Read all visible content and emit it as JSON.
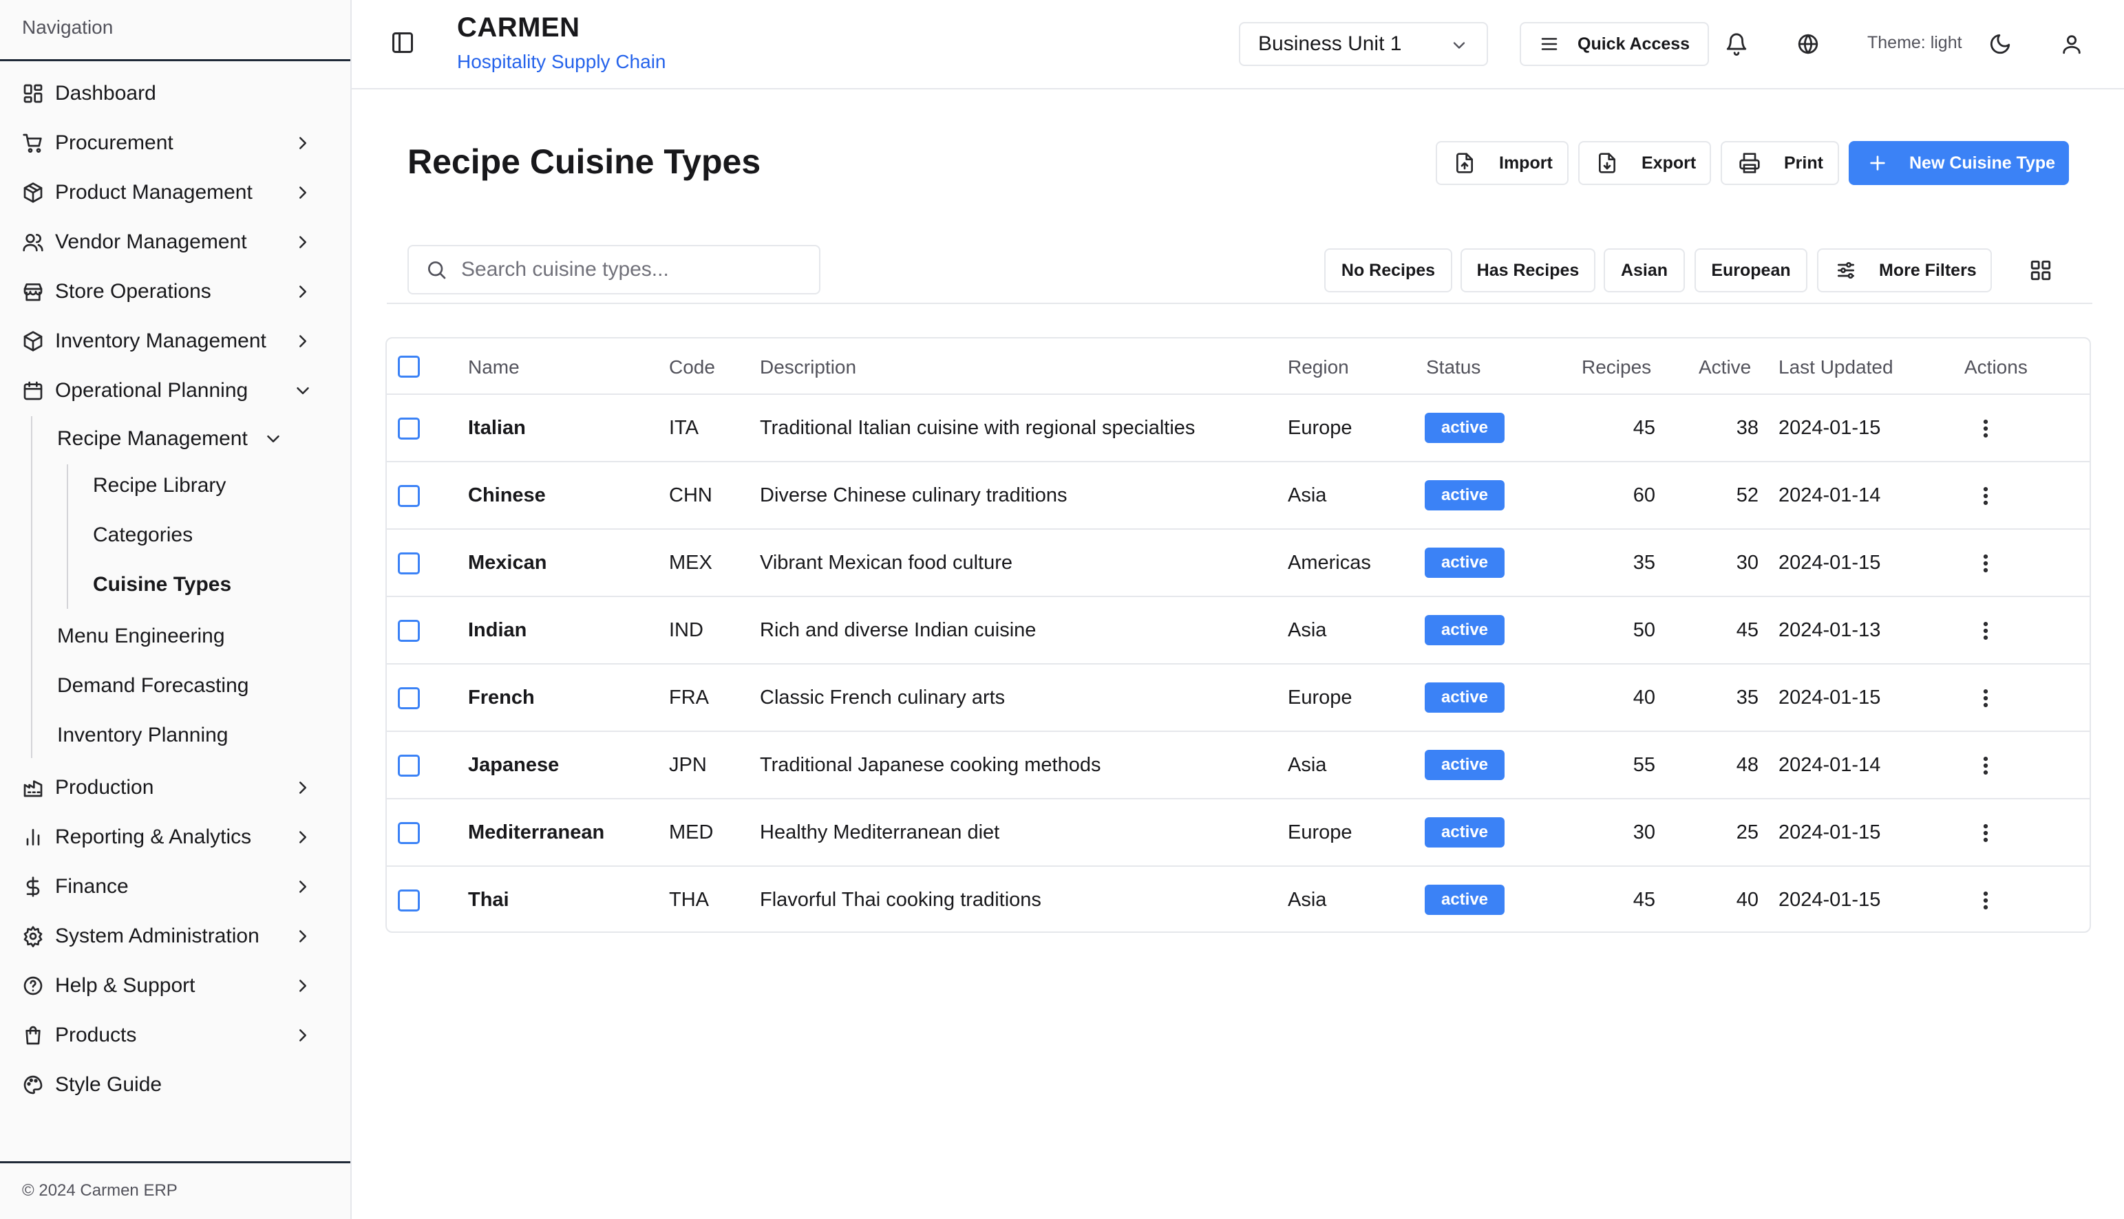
{
  "sidebar": {
    "header": "Navigation",
    "footer": "© 2024 Carmen ERP",
    "items": [
      {
        "label": "Dashboard",
        "icon": "dashboard-icon"
      },
      {
        "label": "Procurement",
        "icon": "cart-icon"
      },
      {
        "label": "Product Management",
        "icon": "package-icon"
      },
      {
        "label": "Vendor Management",
        "icon": "users-icon"
      },
      {
        "label": "Store Operations",
        "icon": "store-icon"
      },
      {
        "label": "Inventory Management",
        "icon": "package-icon"
      },
      {
        "label": "Operational Planning",
        "icon": "calendar-icon"
      },
      {
        "label": "Production",
        "icon": "factory-icon"
      },
      {
        "label": "Reporting & Analytics",
        "icon": "bar-chart-icon"
      },
      {
        "label": "Finance",
        "icon": "dollar-icon"
      },
      {
        "label": "System Administration",
        "icon": "gear-icon"
      },
      {
        "label": "Help & Support",
        "icon": "help-circle-icon"
      },
      {
        "label": "Products",
        "icon": "shopping-bag-icon"
      },
      {
        "label": "Style Guide",
        "icon": "palette-icon"
      }
    ],
    "operational_planning_children": [
      {
        "label": "Recipe Management"
      },
      {
        "label": "Menu Engineering"
      },
      {
        "label": "Demand Forecasting"
      },
      {
        "label": "Inventory Planning"
      }
    ],
    "recipe_management_children": [
      {
        "label": "Recipe Library"
      },
      {
        "label": "Categories"
      },
      {
        "label": "Cuisine Types"
      }
    ]
  },
  "header": {
    "brand": "CARMEN",
    "subtitle": "Hospitality Supply Chain",
    "business_unit": "Business Unit 1",
    "quick_access": "Quick Access",
    "theme_label": "Theme: light"
  },
  "page": {
    "title": "Recipe Cuisine Types",
    "actions": {
      "import": "Import",
      "export": "Export",
      "print": "Print",
      "new": "New Cuisine Type"
    },
    "search_placeholder": "Search cuisine types...",
    "filters": [
      "No Recipes",
      "Has Recipes",
      "Asian",
      "European"
    ],
    "more_filters": "More Filters"
  },
  "table": {
    "columns": [
      "Name",
      "Code",
      "Description",
      "Region",
      "Status",
      "Recipes",
      "Active",
      "Last Updated",
      "Actions"
    ],
    "rows": [
      {
        "name": "Italian",
        "code": "ITA",
        "description": "Traditional Italian cuisine with regional specialties",
        "region": "Europe",
        "status": "active",
        "recipes": "45",
        "active": "38",
        "updated": "2024-01-15"
      },
      {
        "name": "Chinese",
        "code": "CHN",
        "description": "Diverse Chinese culinary traditions",
        "region": "Asia",
        "status": "active",
        "recipes": "60",
        "active": "52",
        "updated": "2024-01-14"
      },
      {
        "name": "Mexican",
        "code": "MEX",
        "description": "Vibrant Mexican food culture",
        "region": "Americas",
        "status": "active",
        "recipes": "35",
        "active": "30",
        "updated": "2024-01-15"
      },
      {
        "name": "Indian",
        "code": "IND",
        "description": "Rich and diverse Indian cuisine",
        "region": "Asia",
        "status": "active",
        "recipes": "50",
        "active": "45",
        "updated": "2024-01-13"
      },
      {
        "name": "French",
        "code": "FRA",
        "description": "Classic French culinary arts",
        "region": "Europe",
        "status": "active",
        "recipes": "40",
        "active": "35",
        "updated": "2024-01-15"
      },
      {
        "name": "Japanese",
        "code": "JPN",
        "description": "Traditional Japanese cooking methods",
        "region": "Asia",
        "status": "active",
        "recipes": "55",
        "active": "48",
        "updated": "2024-01-14"
      },
      {
        "name": "Mediterranean",
        "code": "MED",
        "description": "Healthy Mediterranean diet",
        "region": "Europe",
        "status": "active",
        "recipes": "30",
        "active": "25",
        "updated": "2024-01-15"
      },
      {
        "name": "Thai",
        "code": "THA",
        "description": "Flavorful Thai cooking traditions",
        "region": "Asia",
        "status": "active",
        "recipes": "45",
        "active": "40",
        "updated": "2024-01-15"
      }
    ]
  },
  "colors": {
    "accent": "#3b82f6",
    "brand_subtitle": "#2563eb",
    "border": "#e5e7eb"
  }
}
